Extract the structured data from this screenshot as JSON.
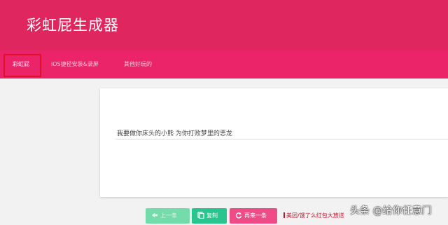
{
  "header": {
    "title": "彩虹屁生成器"
  },
  "tabs": [
    {
      "label": "彩虹屁"
    },
    {
      "label": "iOS捷径安装&录屏"
    },
    {
      "label": "其他好玩的"
    }
  ],
  "content": {
    "sentence": "我要做你床头的小熊 为你打败梦里的恶龙"
  },
  "buttons": {
    "prev_label": "上一条",
    "copy_label": "复制",
    "next_label": "再来一条"
  },
  "promo": {
    "text": "美团/饿了么红包大放送"
  },
  "watermark": {
    "text": "头条 @给你任意门"
  },
  "colors": {
    "header": "#e0265f",
    "tabbar": "#eb2469",
    "copy_button": "#29c58f",
    "next_button": "#ee4b87"
  }
}
